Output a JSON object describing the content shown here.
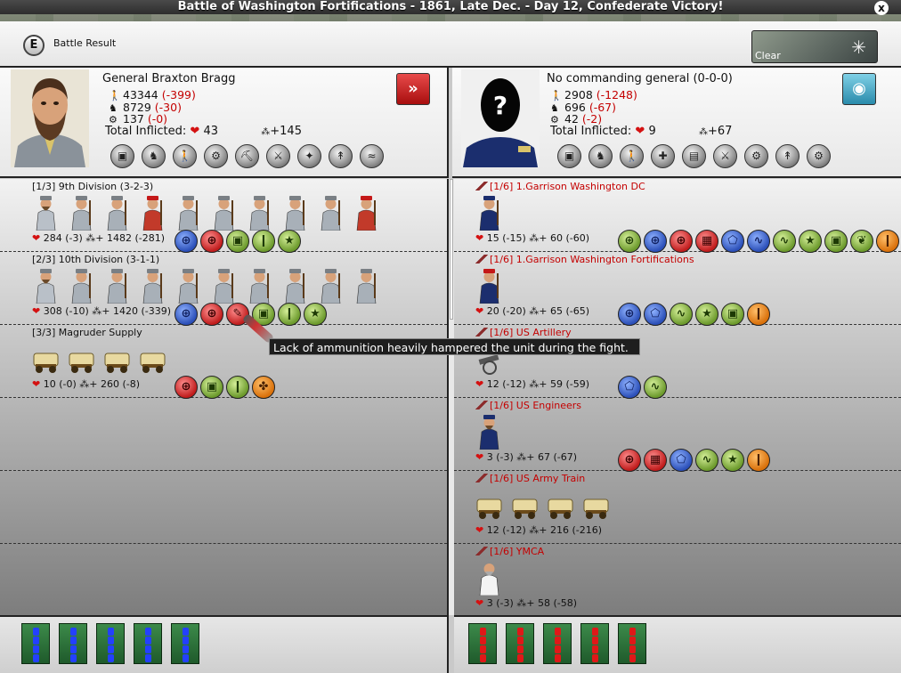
{
  "window": {
    "title": "Battle of Washington Fortifications - 1861, Late Dec. - Day 12, Confederate Victory!",
    "close_label": "x"
  },
  "header": {
    "badge": "E",
    "label": "Battle Result",
    "clear_label": "Clear",
    "clear_icon": "snowflake-icon"
  },
  "left": {
    "commander": "General Braxton Bragg",
    "men": "43344",
    "men_loss": "(-399)",
    "horses": "8729",
    "horses_loss": "(-30)",
    "guns": "137",
    "guns_loss": "(-0)",
    "inflicted_label": "Total Inflicted:",
    "inflicted_hits": "43",
    "inflicted_cohesion": "+145",
    "mode_icon": "assault-icon",
    "mode_symbol": "»",
    "badges": [
      "supply",
      "cavalry",
      "infantry",
      "artillery",
      "engineer",
      "militia",
      "elite",
      "skirmish",
      "river"
    ],
    "divisions": [
      {
        "title": "[1/3] 9th Division (3-2-3)",
        "hits": "284",
        "hits_loss": "(-3)",
        "cohesion": "1482",
        "cohesion_loss": "(-281)",
        "units": [
          "leader",
          "inf",
          "inf",
          "zouave",
          "inf",
          "inf",
          "inf",
          "inf",
          "inf",
          "zouave"
        ],
        "traits": [
          {
            "color": "blue",
            "sym": "⊕"
          },
          {
            "color": "red",
            "sym": "⊕"
          },
          {
            "color": "green",
            "sym": "▣"
          },
          {
            "color": "green",
            "sym": "❙"
          },
          {
            "color": "green",
            "sym": "★"
          }
        ]
      },
      {
        "title": "[2/3] 10th Division (3-1-1)",
        "hits": "308",
        "hits_loss": "(-10)",
        "cohesion": "1420",
        "cohesion_loss": "(-339)",
        "units": [
          "leader",
          "inf",
          "inf",
          "inf",
          "inf",
          "inf",
          "inf",
          "inf",
          "inf",
          "inf"
        ],
        "traits": [
          {
            "color": "blue",
            "sym": "⊕"
          },
          {
            "color": "red",
            "sym": "⊕"
          },
          {
            "color": "red",
            "sym": "✎"
          },
          {
            "color": "green",
            "sym": "▣"
          },
          {
            "color": "green",
            "sym": "❙"
          },
          {
            "color": "green",
            "sym": "★"
          }
        ]
      },
      {
        "title": "[3/3] Magruder Supply",
        "hits": "10",
        "hits_loss": "(-0)",
        "cohesion": "260",
        "cohesion_loss": "(-8)",
        "units": [
          "wagon",
          "wagon",
          "wagon",
          "wagon"
        ],
        "traits": [
          {
            "color": "red",
            "sym": "⊕"
          },
          {
            "color": "green",
            "sym": "▣"
          },
          {
            "color": "green",
            "sym": "❙"
          },
          {
            "color": "orange",
            "sym": "✤"
          }
        ]
      }
    ],
    "dice": [
      4,
      4,
      4,
      4,
      4
    ]
  },
  "right": {
    "commander": "No commanding general (0-0-0)",
    "men": "2908",
    "men_loss": "(-1248)",
    "horses": "696",
    "horses_loss": "(-67)",
    "guns": "42",
    "guns_loss": "(-2)",
    "inflicted_label": "Total Inflicted:",
    "inflicted_hits": "9",
    "inflicted_cohesion": "+67",
    "mode_icon": "defend-icon",
    "mode_symbol": "◉",
    "badges": [
      "supply",
      "cavalry",
      "infantry",
      "medic",
      "wagon",
      "militia",
      "artillery",
      "skirmish",
      "cannon"
    ],
    "units": [
      {
        "title": "[1/6] 1.Garrison Washington DC",
        "hits": "15",
        "hits_loss": "(-15)",
        "cohesion": "60",
        "cohesion_loss": "(-60)",
        "units": [
          "soldier"
        ],
        "traits": [
          {
            "color": "green",
            "sym": "⊕"
          },
          {
            "color": "blue",
            "sym": "⊕"
          },
          {
            "color": "red",
            "sym": "⊕"
          },
          {
            "color": "red",
            "sym": "▦"
          },
          {
            "color": "blue",
            "sym": "⬠"
          },
          {
            "color": "blue",
            "sym": "∿"
          },
          {
            "color": "green",
            "sym": "∿"
          },
          {
            "color": "green",
            "sym": "★"
          },
          {
            "color": "green",
            "sym": "▣"
          },
          {
            "color": "green",
            "sym": "❦"
          },
          {
            "color": "orange",
            "sym": "❙"
          }
        ]
      },
      {
        "title": "[1/6] 1.Garrison Washington Fortifications",
        "hits": "20",
        "hits_loss": "(-20)",
        "cohesion": "65",
        "cohesion_loss": "(-65)",
        "units": [
          "zouave"
        ],
        "traits": [
          {
            "color": "blue",
            "sym": "⊕"
          },
          {
            "color": "blue",
            "sym": "⬠"
          },
          {
            "color": "green",
            "sym": "∿"
          },
          {
            "color": "green",
            "sym": "★"
          },
          {
            "color": "green",
            "sym": "▣"
          },
          {
            "color": "orange",
            "sym": "❙"
          }
        ]
      },
      {
        "title": "[1/6] US Artillery",
        "hits": "12",
        "hits_loss": "(-12)",
        "cohesion": "59",
        "cohesion_loss": "(-59)",
        "units": [
          "cannon"
        ],
        "traits": [
          {
            "color": "blue",
            "sym": "⬠"
          },
          {
            "color": "green",
            "sym": "∿"
          }
        ]
      },
      {
        "title": "[1/6] US Engineers",
        "hits": "3",
        "hits_loss": "(-3)",
        "cohesion": "67",
        "cohesion_loss": "(-67)",
        "units": [
          "engineer"
        ],
        "traits": [
          {
            "color": "red",
            "sym": "⊕"
          },
          {
            "color": "red",
            "sym": "▦"
          },
          {
            "color": "blue",
            "sym": "⬠"
          },
          {
            "color": "green",
            "sym": "∿"
          },
          {
            "color": "green",
            "sym": "★"
          },
          {
            "color": "orange",
            "sym": "❙"
          }
        ]
      },
      {
        "title": "[1/6] US Army Train",
        "hits": "12",
        "hits_loss": "(-12)",
        "cohesion": "216",
        "cohesion_loss": "(-216)",
        "units": [
          "wagon",
          "wagon",
          "wagon",
          "wagon"
        ],
        "traits": []
      },
      {
        "title": "[1/6] YMCA",
        "hits": "3",
        "hits_loss": "(-3)",
        "cohesion": "58",
        "cohesion_loss": "(-58)",
        "units": [
          "civilian"
        ],
        "traits": []
      }
    ],
    "dice": [
      4,
      4,
      4,
      4,
      4
    ]
  },
  "tooltip": "Lack of ammunition heavily hampered the unit during the fight.",
  "colors": {
    "loss": "#c40000",
    "heart": "#d41111",
    "confederate_gray": "#a8b0b8",
    "union_blue": "#1b2e6e"
  }
}
